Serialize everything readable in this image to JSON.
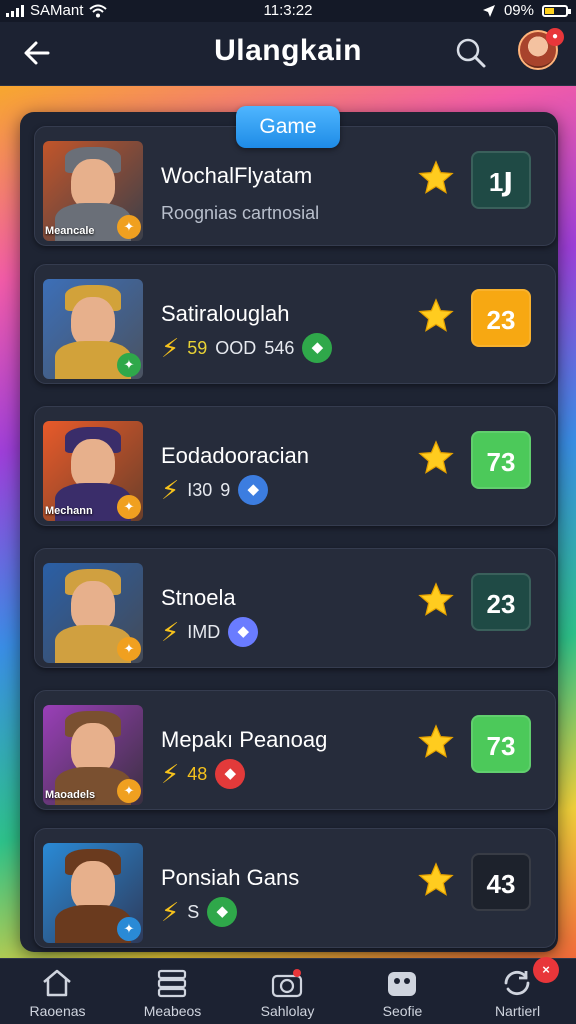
{
  "status_bar": {
    "carrier": "SAMant",
    "time": "11:3:22",
    "battery": "09%"
  },
  "header": {
    "title": "Ulangkain",
    "back_icon": "arrow-left-icon",
    "search_icon": "search-icon",
    "notification_count": ""
  },
  "category_pill": "Game",
  "games": [
    {
      "name": "WochalFlyatam",
      "subtitle": "Roognias cartnosial",
      "thumb_caption": "Meancale",
      "score": "1Ϳ",
      "score_color": "#1f4a45",
      "thumb_colors": [
        "#c2552a",
        "#6a6f78",
        "#3a3f4a"
      ],
      "corner_color": "#f0a020"
    },
    {
      "name": "Satiralouglah",
      "meta": [
        "59",
        "OOD",
        "546"
      ],
      "thumb_caption": "",
      "score": "23",
      "score_color": "#f7a812",
      "thumb_colors": [
        "#3c6fb8",
        "#d2a23a",
        "#4a5260"
      ],
      "corner_color": "#2fa84a"
    },
    {
      "name": "Eodadooracian",
      "meta": [
        "I30",
        "9"
      ],
      "thumb_caption": "Mechann",
      "score": "73",
      "score_color": "#4cc95a",
      "thumb_colors": [
        "#e85a2a",
        "#3a2d6a",
        "#6a3f2a"
      ],
      "corner_color": "#f0a020"
    },
    {
      "name": "Stnoela",
      "meta": [
        "IMD"
      ],
      "thumb_caption": "",
      "score": "23",
      "score_color": "#1f4a45",
      "thumb_colors": [
        "#2a5fa6",
        "#d0a040",
        "#444a56"
      ],
      "corner_color": "#f0a020"
    },
    {
      "name": "Mepakı Peanoag",
      "meta": [
        "48"
      ],
      "thumb_caption": "Maoadels",
      "score": "73",
      "score_color": "#4cc95a",
      "thumb_colors": [
        "#9a3fb8",
        "#7a5030",
        "#3a3040"
      ],
      "corner_color": "#f0a020"
    },
    {
      "name": "Ponsiah Gans",
      "meta": [
        "S"
      ],
      "thumb_caption": "",
      "score": "43",
      "score_color": "#1d222c",
      "thumb_colors": [
        "#2a8ad6",
        "#6a3a1e",
        "#2e3a5a"
      ],
      "corner_color": "#2a8ad6"
    }
  ],
  "bottom_nav": [
    {
      "label": "Raoenas",
      "icon": "home-icon"
    },
    {
      "label": "Meabeos",
      "icon": "stack-icon"
    },
    {
      "label": "Sahlolay",
      "icon": "camera-icon"
    },
    {
      "label": "Seofie",
      "icon": "game-controller-icon"
    },
    {
      "label": "Nartierl",
      "icon": "refresh-icon",
      "badge": "×"
    }
  ]
}
